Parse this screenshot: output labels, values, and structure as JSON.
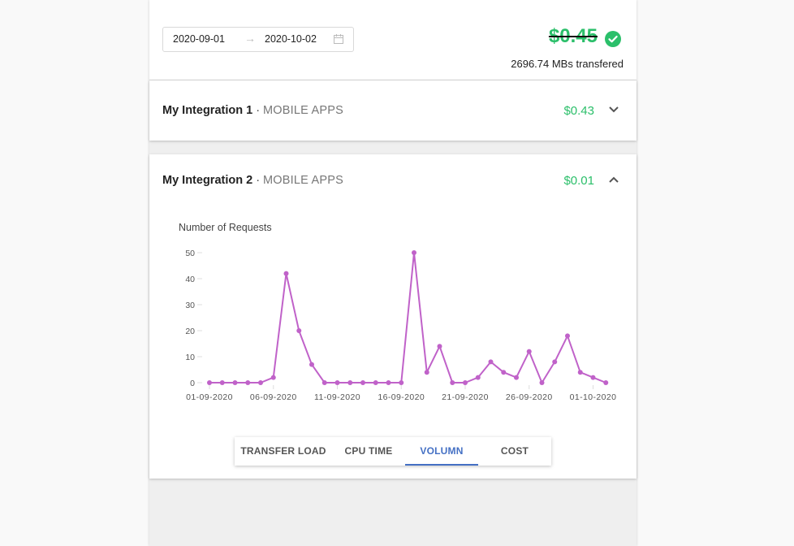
{
  "summary": {
    "date_start": "2020-09-01",
    "date_arrow": "→",
    "date_end": "2020-10-02",
    "total": "$0.45",
    "transfer_text": "2696.74 MBs transfered"
  },
  "integrations": [
    {
      "name": "My Integration 1",
      "separator": "·",
      "type": "MOBILE APPS",
      "price": "$0.43",
      "expanded": false
    },
    {
      "name": "My Integration 2",
      "separator": "·",
      "type": "MOBILE APPS",
      "price": "$0.01",
      "expanded": true
    }
  ],
  "chart_title": "Number of Requests",
  "tabs": [
    {
      "label": "TRANSFER LOAD",
      "active": false
    },
    {
      "label": "CPU TIME",
      "active": false
    },
    {
      "label": "VOLUMN",
      "active": true
    },
    {
      "label": "COST",
      "active": false
    }
  ],
  "colors": {
    "accent_green": "#2bbf6a",
    "line": "#c062c9",
    "tab_active": "#4470c4"
  },
  "chart_data": {
    "type": "line",
    "title": "Number of Requests",
    "xlabel": "",
    "ylabel": "",
    "ylim": [
      0,
      50
    ],
    "yticks": [
      0,
      10,
      20,
      30,
      40,
      50
    ],
    "x": [
      "01-09-2020",
      "02-09-2020",
      "03-09-2020",
      "04-09-2020",
      "05-09-2020",
      "06-09-2020",
      "07-09-2020",
      "08-09-2020",
      "09-09-2020",
      "10-09-2020",
      "11-09-2020",
      "12-09-2020",
      "13-09-2020",
      "14-09-2020",
      "15-09-2020",
      "16-09-2020",
      "17-09-2020",
      "18-09-2020",
      "19-09-2020",
      "20-09-2020",
      "21-09-2020",
      "22-09-2020",
      "23-09-2020",
      "24-09-2020",
      "25-09-2020",
      "26-09-2020",
      "27-09-2020",
      "28-09-2020",
      "29-09-2020",
      "30-09-2020",
      "01-10-2020"
    ],
    "xtick_labels": [
      "01-09-2020",
      "06-09-2020",
      "11-09-2020",
      "16-09-2020",
      "21-09-2020",
      "26-09-2020",
      "01-10-2020"
    ],
    "values": [
      0,
      0,
      0,
      0,
      0,
      2,
      42,
      20,
      7,
      0,
      0,
      0,
      0,
      0,
      0,
      0,
      50,
      4,
      14,
      0,
      0,
      2,
      8,
      4,
      2,
      12,
      0,
      8,
      18,
      4,
      2,
      0
    ],
    "grid": false,
    "legend": "none"
  }
}
